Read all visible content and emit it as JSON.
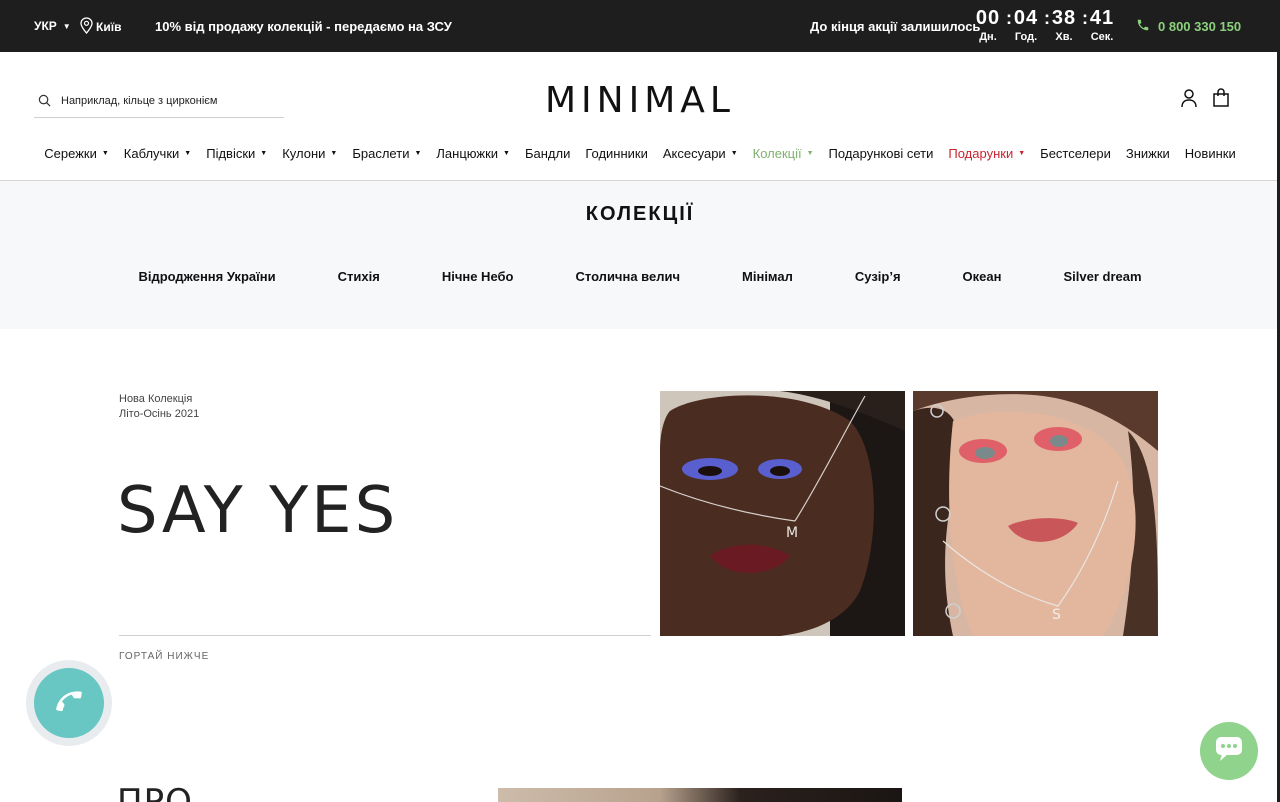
{
  "topbar": {
    "language": "УКР",
    "city": "Київ",
    "promo": "10% від продажу колекцій - передаємо на ЗСУ",
    "countdown_label": "До кінця акції залишилось",
    "timer": {
      "days": "00",
      "days_label": "Дн.",
      "hours": "04",
      "hours_label": "Год.",
      "minutes": "38",
      "minutes_label": "Хв.",
      "seconds": "41",
      "seconds_label": "Сек.",
      "separator": ":"
    },
    "phone": "0 800 330 150",
    "phone_color": "#8bd17c",
    "icons": {
      "language": "chevron-down-icon",
      "city": "location-pin-icon",
      "phone": "phone-icon"
    }
  },
  "header": {
    "logo": "MINIMAL",
    "search": {
      "placeholder": "Наприклад, кільце з цирконієм",
      "value": ""
    },
    "icons": {
      "search": "search-icon",
      "account": "user-icon",
      "cart": "shopping-bag-icon"
    }
  },
  "nav": {
    "items": [
      {
        "label": "Сережки",
        "dropdown": true
      },
      {
        "label": "Каблучки",
        "dropdown": true
      },
      {
        "label": "Підвіски",
        "dropdown": true
      },
      {
        "label": "Кулони",
        "dropdown": true
      },
      {
        "label": "Браслети",
        "dropdown": true
      },
      {
        "label": "Ланцюжки",
        "dropdown": true
      },
      {
        "label": "Бандли",
        "dropdown": false
      },
      {
        "label": "Годинники",
        "dropdown": false
      },
      {
        "label": "Аксесуари",
        "dropdown": true
      },
      {
        "label": "Колекції",
        "dropdown": true,
        "color": "#7fb06f"
      },
      {
        "label": "Подарункові сети",
        "dropdown": false
      },
      {
        "label": "Подарунки",
        "dropdown": true,
        "color": "#c8252f"
      },
      {
        "label": "Бестселери",
        "dropdown": false
      },
      {
        "label": "Знижки",
        "dropdown": false
      },
      {
        "label": "Новинки",
        "dropdown": false
      }
    ]
  },
  "collections": {
    "title": "КОЛЕКЦІЇ",
    "items": [
      "Відродження України",
      "Стихія",
      "Нічне Небо",
      "Столична велич",
      "Мінімал",
      "Сузір’я",
      "Океан",
      "Silver dream"
    ]
  },
  "hero": {
    "eyebrow_line1": "Нова Колекція",
    "eyebrow_line2": "Літо-Осінь 2021",
    "title": "SAY YES",
    "scroll_hint": "ГОРТАЙ НИЖЧЕ"
  },
  "about": {
    "title": "ПРО"
  },
  "floating": {
    "call_icon": "phone-icon",
    "call_color": "#68c6c3",
    "chat_icon": "chat-bubble-icon",
    "chat_color": "#8fd38c"
  }
}
